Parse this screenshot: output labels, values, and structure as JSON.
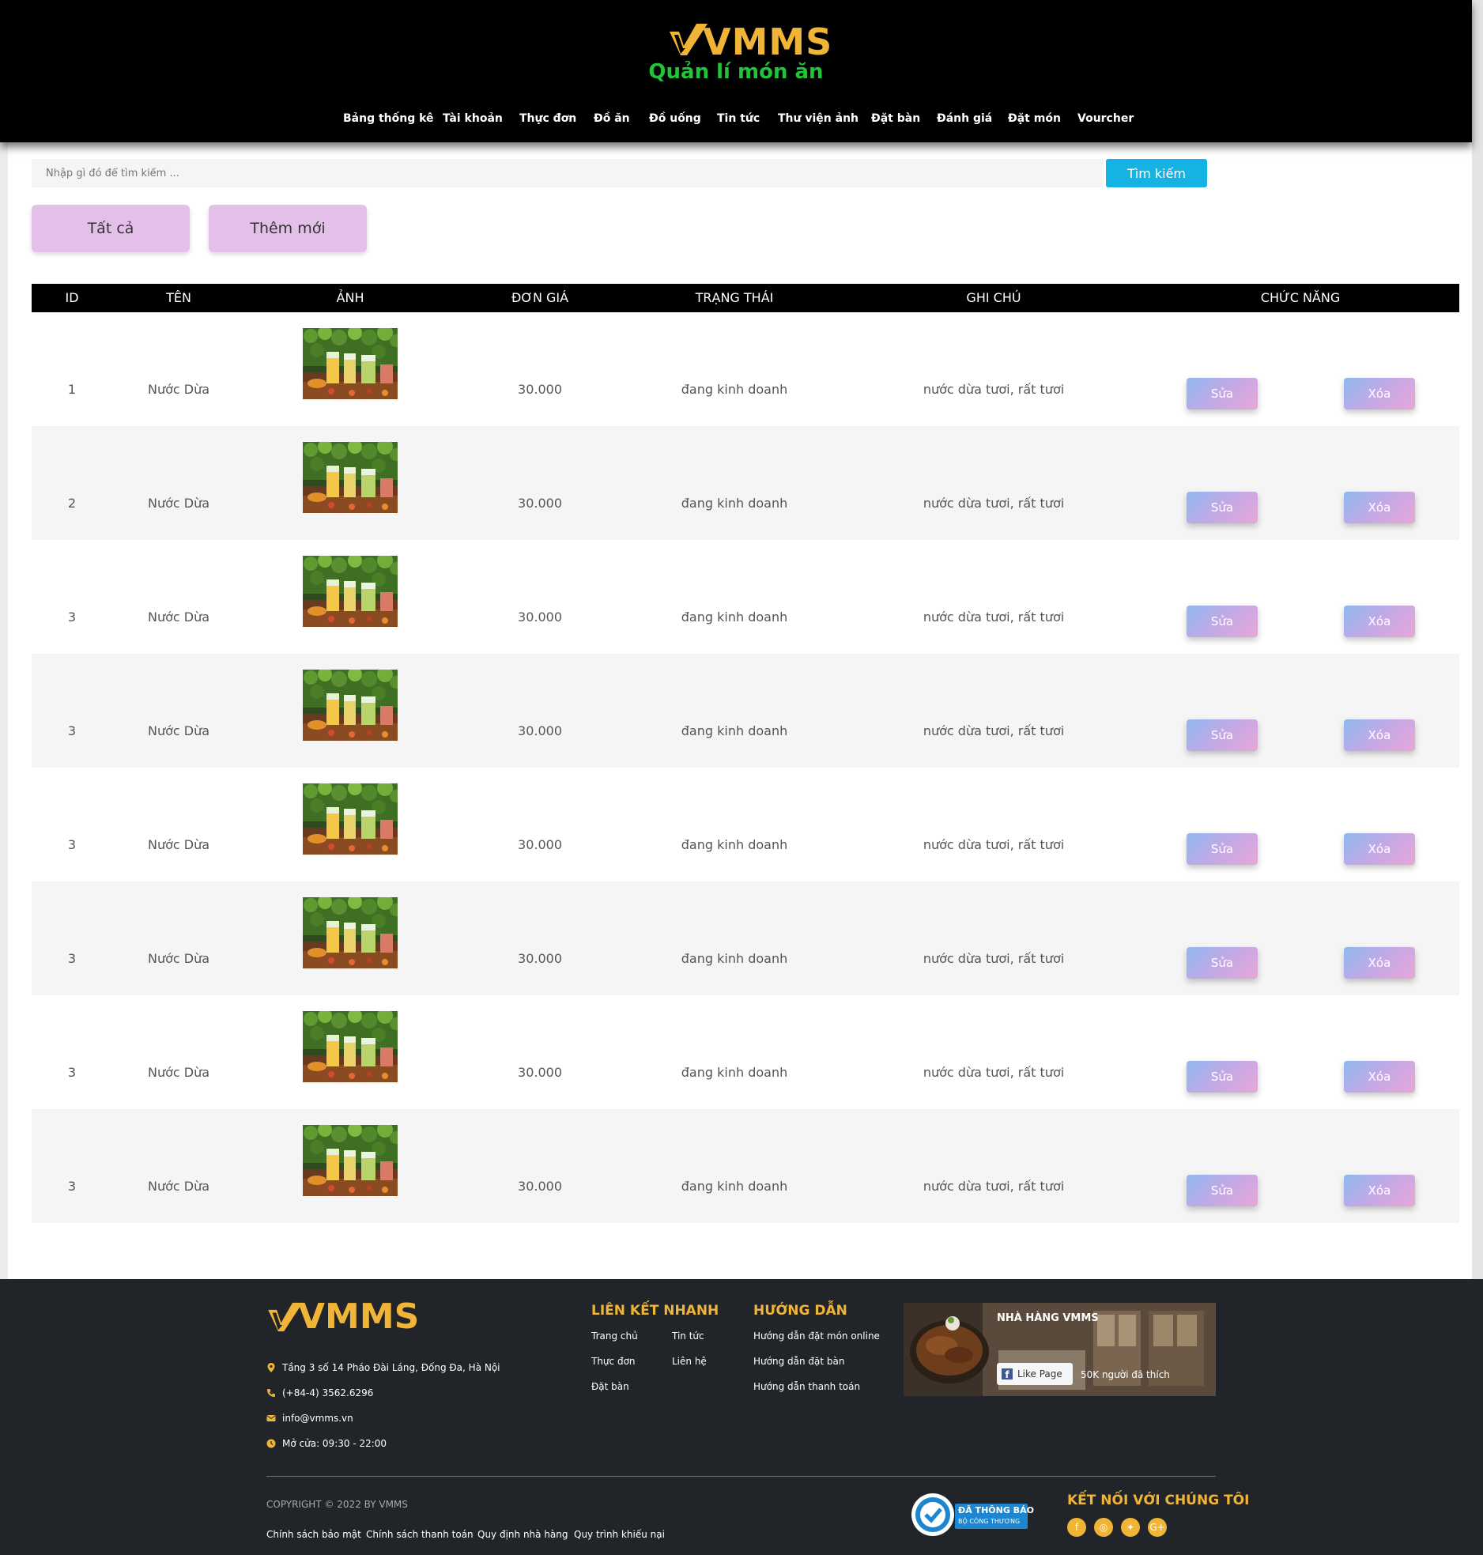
{
  "header": {
    "logo": "VMMS",
    "subtitle": "Quản lí món ăn",
    "nav": [
      "Bảng thống kê",
      "Tài khoản",
      "Thực đơn",
      "Đồ ăn",
      "Đồ uống",
      "Tin tức",
      "Thư viện ảnh",
      "Đặt bàn",
      "Đánh giá",
      "Đặt món",
      "Vourcher"
    ]
  },
  "search": {
    "placeholder": "Nhập gì đó để tìm kiếm ...",
    "button": "Tìm kiếm"
  },
  "actions": {
    "all": "Tất cả",
    "add_new": "Thêm mới"
  },
  "table": {
    "columns": [
      "ID",
      "TÊN",
      "ẢNH",
      "ĐƠN GIÁ",
      "TRẠNG THÁI",
      "GHI CHÚ",
      "CHỨC NĂNG"
    ],
    "rows": [
      {
        "id": "1",
        "name": "Nước Dừa",
        "image": "drinks-photo",
        "price": "30.000",
        "status": "đang kinh doanh",
        "note": "nước dừa tươi, rất tươi",
        "edit": "Sửa",
        "delete": "Xóa"
      },
      {
        "id": "2",
        "name": "Nước Dừa",
        "image": "drinks-photo",
        "price": "30.000",
        "status": "đang kinh doanh",
        "note": "nước dừa tươi, rất tươi",
        "edit": "Sửa",
        "delete": "Xóa"
      },
      {
        "id": "3",
        "name": "Nước Dừa",
        "image": "drinks-photo",
        "price": "30.000",
        "status": "đang kinh doanh",
        "note": "nước dừa tươi, rất tươi",
        "edit": "Sửa",
        "delete": "Xóa"
      },
      {
        "id": "3",
        "name": "Nước Dừa",
        "image": "drinks-photo",
        "price": "30.000",
        "status": "đang kinh doanh",
        "note": "nước dừa tươi, rất tươi",
        "edit": "Sửa",
        "delete": "Xóa"
      },
      {
        "id": "3",
        "name": "Nước Dừa",
        "image": "drinks-photo",
        "price": "30.000",
        "status": "đang kinh doanh",
        "note": "nước dừa tươi, rất tươi",
        "edit": "Sửa",
        "delete": "Xóa"
      },
      {
        "id": "3",
        "name": "Nước Dừa",
        "image": "drinks-photo",
        "price": "30.000",
        "status": "đang kinh doanh",
        "note": "nước dừa tươi, rất tươi",
        "edit": "Sửa",
        "delete": "Xóa"
      },
      {
        "id": "3",
        "name": "Nước Dừa",
        "image": "drinks-photo",
        "price": "30.000",
        "status": "đang kinh doanh",
        "note": "nước dừa tươi, rất tươi",
        "edit": "Sửa",
        "delete": "Xóa"
      },
      {
        "id": "3",
        "name": "Nước Dừa",
        "image": "drinks-photo",
        "price": "30.000",
        "status": "đang kinh doanh",
        "note": "nước dừa tươi, rất tươi",
        "edit": "Sửa",
        "delete": "Xóa"
      }
    ]
  },
  "footer": {
    "logo": "VMMS",
    "address": "Tầng 3 số 14 Pháo Đài Láng, Đống Đa, Hà Nội",
    "phone": "(+84-4) 3562.6296",
    "email": "info@vmms.vn",
    "hours": "Mở cửa: 09:30 - 22:00",
    "quick_links_title": "LIÊN KẾT NHANH",
    "quick_links": [
      "Trang chủ",
      "Tin tức",
      "Thực đơn",
      "Liên hệ",
      "Đặt bàn"
    ],
    "guide_title": "HƯỚNG DẪN",
    "guides": [
      "Hướng dẫn đặt món online",
      "Hướng dẫn đặt bàn",
      "Hướng dẫn thanh toán"
    ],
    "fb_page": "NHÀ HÀNG VMMS",
    "fb_like": "Like Page",
    "fb_likes_count": "50K người đã thích",
    "copyright": "COPYRIGHT © 2022 BY VMMS",
    "policies": [
      "Chính sách bảo mật",
      "Chính sách thanh toán",
      "Quy định nhà hàng",
      "Quy trình khiếu nại"
    ],
    "badge_line1": "ĐÃ THÔNG BÁO",
    "badge_line2": "BỘ CÔNG THƯƠNG",
    "connect_title": "KẾT NỐI VỚI CHÚNG TÔI",
    "social_icons": [
      "facebook-icon",
      "instagram-icon",
      "twitter-icon",
      "google-plus-icon"
    ],
    "colors": {
      "accent": "#f0b437",
      "background": "#212529"
    }
  },
  "colors": {
    "header_bg": "#000000",
    "subtitle": "#22c53a",
    "search_button": "#15b2e4",
    "pill": "#e3bfe9"
  }
}
